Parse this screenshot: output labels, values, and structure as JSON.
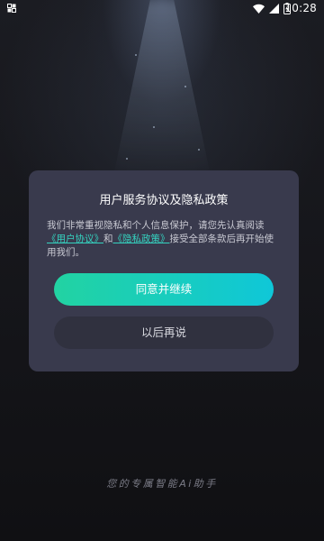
{
  "status_bar": {
    "time": "10:28",
    "icons": [
      "screen-record-icon",
      "wifi-icon",
      "signal-icon",
      "battery-charging-icon"
    ]
  },
  "dialog": {
    "title": "用户服务协议及隐私政策",
    "body_before": "我们非常重视隐私和个人信息保护，请您先认真阅读",
    "link_user_agreement": "《用户协议》",
    "body_and": "和",
    "link_privacy_policy": "《隐私政策》",
    "body_after": "接受全部条款后再开始使用我们。",
    "agree_button": "同意并继续",
    "later_button": "以后再说"
  },
  "slogan": "您的专属智能Ai助手",
  "colors": {
    "accent_start": "#22d3a2",
    "accent_end": "#0fc7d8",
    "link": "#35d3c0",
    "dialog_bg": "#393a4d",
    "page_bg": "#131317"
  }
}
